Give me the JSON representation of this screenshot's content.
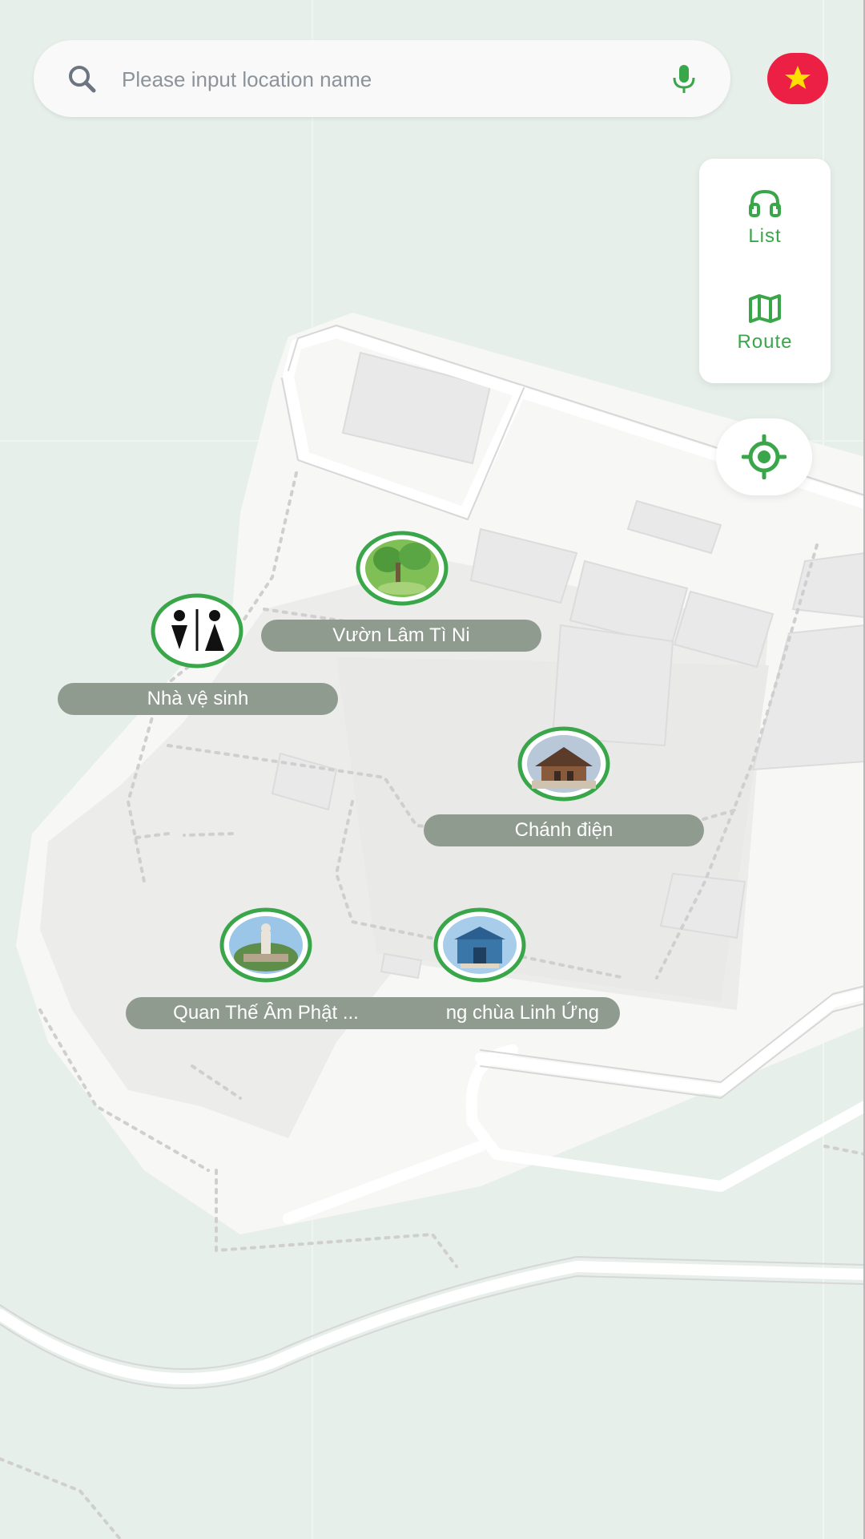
{
  "search": {
    "placeholder": "Please input location name",
    "search_icon": "search-icon",
    "voice_icon": "microphone-icon"
  },
  "language": {
    "flag_icon": "vietnam-flag-icon"
  },
  "side_panel": {
    "list_label": "List",
    "list_icon": "headphones-icon",
    "route_label": "Route",
    "route_icon": "map-icon"
  },
  "locate_button": {
    "icon": "locate-crosshair-icon"
  },
  "pois": [
    {
      "label": "Vườn Lâm Tì Ni",
      "icon": "garden-photo"
    },
    {
      "label": "Nhà vệ sinh",
      "icon": "restroom-icon"
    },
    {
      "label": "Chánh điện",
      "icon": "temple-photo"
    },
    {
      "label": "Quan Thế Âm Phật ...",
      "icon": "statue-photo"
    },
    {
      "label": "ng chùa Linh Ứng",
      "icon": "gate-photo"
    }
  ],
  "colors": {
    "accent": "#3aa64a",
    "label_bg": "#909b90",
    "flag_red": "#ec1f45",
    "flag_star": "#ffde00"
  }
}
